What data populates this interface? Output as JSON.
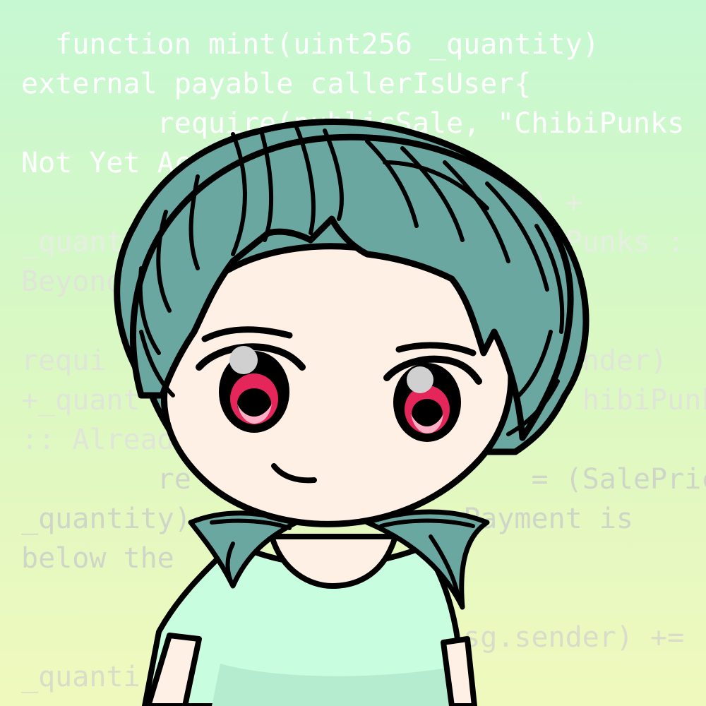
{
  "code_text": {
    "lines": [
      "  function mint(uint256 _quantity)",
      "external payable callerIsUser{",
      "        require(publicSale, \"ChibiPunks",
      "Not Yet Active\");",
      "                              ) +",
      "_quantity                       Punks :",
      "Beyond",
      "requi                            nder)",
      "+_quant                          hibiPunk",
      ":: Alread",
      "        re                    = (SalePrice",
      "_quantity)                Payment is",
      "below the",
      "                          sg.sender) +=",
      "_quanti"
    ]
  },
  "colors": {
    "hair": "#6aa7a1",
    "skin": "#fef0e4",
    "shirt": "#c9fde0",
    "eyes": "#e4265b",
    "outline": "#000000"
  },
  "figure": {
    "subject": "chibi-avatar"
  }
}
